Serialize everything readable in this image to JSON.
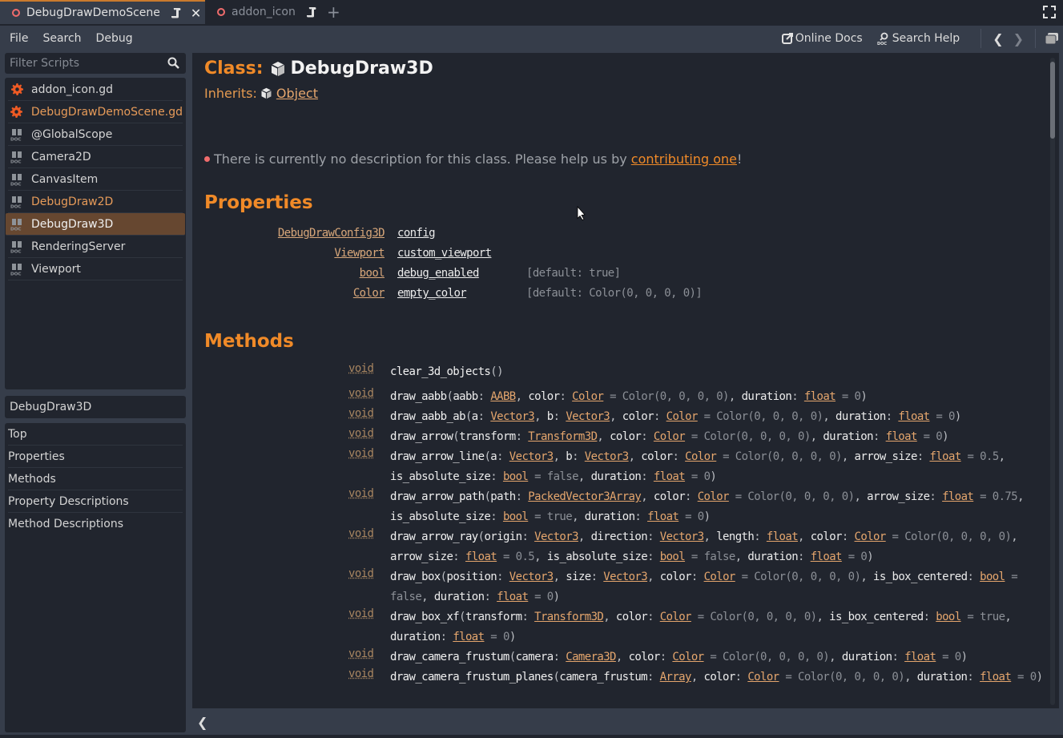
{
  "tabs": [
    {
      "label": "DebugDrawDemoScene",
      "active": true,
      "closable": true
    },
    {
      "label": "addon_icon",
      "active": false,
      "closable": false
    }
  ],
  "menu": [
    "File",
    "Search",
    "Debug"
  ],
  "toolbar": {
    "online_docs": "Online Docs",
    "search_help": "Search Help"
  },
  "filter": {
    "placeholder": "Filter Scripts",
    "value": ""
  },
  "scripts": [
    {
      "label": "addon_icon.gd",
      "icon": "gear-icon",
      "highlight": false,
      "selected": false
    },
    {
      "label": "DebugDrawDemoScene.gd",
      "icon": "gear-icon",
      "highlight": true,
      "selected": false
    },
    {
      "label": "@GlobalScope",
      "icon": "doc-icon",
      "highlight": false,
      "selected": false
    },
    {
      "label": "Camera2D",
      "icon": "doc-icon",
      "highlight": false,
      "selected": false
    },
    {
      "label": "CanvasItem",
      "icon": "doc-icon",
      "highlight": false,
      "selected": false
    },
    {
      "label": "DebugDraw2D",
      "icon": "doc-icon",
      "highlight": true,
      "selected": false
    },
    {
      "label": "DebugDraw3D",
      "icon": "doc-icon",
      "highlight": false,
      "selected": true
    },
    {
      "label": "RenderingServer",
      "icon": "doc-icon",
      "highlight": false,
      "selected": false
    },
    {
      "label": "Viewport",
      "icon": "doc-icon",
      "highlight": false,
      "selected": false
    }
  ],
  "current_class": "DebugDraw3D",
  "sections": [
    "Top",
    "Properties",
    "Methods",
    "Property Descriptions",
    "Method Descriptions"
  ],
  "doc": {
    "class_label": "Class:",
    "class_name": "DebugDraw3D",
    "inherits_label": "Inherits:",
    "inherits_name": "Object",
    "nodesc_text": "There is currently no description for this class. Please help us by ",
    "nodesc_link": "contributing one",
    "nodesc_tail": "!",
    "properties_heading": "Properties",
    "methods_heading": "Methods",
    "properties": [
      {
        "type": "DebugDrawConfig3D",
        "name": "config",
        "default": ""
      },
      {
        "type": "Viewport",
        "name": "custom_viewport",
        "default": ""
      },
      {
        "type": "bool",
        "name": "debug_enabled",
        "default": "[default: true]"
      },
      {
        "type": "Color",
        "name": "empty_color",
        "default": "[default: Color(0, 0, 0, 0)]"
      }
    ],
    "methods": [
      {
        "ret": "void",
        "name": "clear_3d_objects",
        "params": []
      },
      {
        "ret": "void",
        "name": "draw_aabb",
        "params": [
          {
            "n": "aabb",
            "t": "AABB"
          },
          {
            "n": "color",
            "t": "Color",
            "d": "Color(0, 0, 0, 0)"
          },
          {
            "n": "duration",
            "t": "float",
            "d": "0"
          }
        ]
      },
      {
        "ret": "void",
        "name": "draw_aabb_ab",
        "params": [
          {
            "n": "a",
            "t": "Vector3"
          },
          {
            "n": "b",
            "t": "Vector3"
          },
          {
            "n": "color",
            "t": "Color",
            "d": "Color(0, 0, 0, 0)"
          },
          {
            "n": "duration",
            "t": "float",
            "d": "0"
          }
        ]
      },
      {
        "ret": "void",
        "name": "draw_arrow",
        "params": [
          {
            "n": "transform",
            "t": "Transform3D"
          },
          {
            "n": "color",
            "t": "Color",
            "d": "Color(0, 0, 0, 0)"
          },
          {
            "n": "duration",
            "t": "float",
            "d": "0"
          }
        ]
      },
      {
        "ret": "void",
        "name": "draw_arrow_line",
        "params": [
          {
            "n": "a",
            "t": "Vector3"
          },
          {
            "n": "b",
            "t": "Vector3"
          },
          {
            "n": "color",
            "t": "Color",
            "d": "Color(0, 0, 0, 0)"
          },
          {
            "n": "arrow_size",
            "t": "float",
            "d": "0.5"
          },
          {
            "n": "is_absolute_size",
            "t": "bool",
            "d": "false"
          },
          {
            "n": "duration",
            "t": "float",
            "d": "0"
          }
        ]
      },
      {
        "ret": "void",
        "name": "draw_arrow_path",
        "params": [
          {
            "n": "path",
            "t": "PackedVector3Array"
          },
          {
            "n": "color",
            "t": "Color",
            "d": "Color(0, 0, 0, 0)"
          },
          {
            "n": "arrow_size",
            "t": "float",
            "d": "0.75"
          },
          {
            "n": "is_absolute_size",
            "t": "bool",
            "d": "true"
          },
          {
            "n": "duration",
            "t": "float",
            "d": "0"
          }
        ]
      },
      {
        "ret": "void",
        "name": "draw_arrow_ray",
        "params": [
          {
            "n": "origin",
            "t": "Vector3"
          },
          {
            "n": "direction",
            "t": "Vector3"
          },
          {
            "n": "length",
            "t": "float"
          },
          {
            "n": "color",
            "t": "Color",
            "d": "Color(0, 0, 0, 0)"
          },
          {
            "n": "arrow_size",
            "t": "float",
            "d": "0.5"
          },
          {
            "n": "is_absolute_size",
            "t": "bool",
            "d": "false"
          },
          {
            "n": "duration",
            "t": "float",
            "d": "0"
          }
        ]
      },
      {
        "ret": "void",
        "name": "draw_box",
        "params": [
          {
            "n": "position",
            "t": "Vector3"
          },
          {
            "n": "size",
            "t": "Vector3"
          },
          {
            "n": "color",
            "t": "Color",
            "d": "Color(0, 0, 0, 0)"
          },
          {
            "n": "is_box_centered",
            "t": "bool",
            "d": "false"
          },
          {
            "n": "duration",
            "t": "float",
            "d": "0"
          }
        ]
      },
      {
        "ret": "void",
        "name": "draw_box_xf",
        "params": [
          {
            "n": "transform",
            "t": "Transform3D"
          },
          {
            "n": "color",
            "t": "Color",
            "d": "Color(0, 0, 0, 0)"
          },
          {
            "n": "is_box_centered",
            "t": "bool",
            "d": "true"
          },
          {
            "n": "duration",
            "t": "float",
            "d": "0"
          }
        ]
      },
      {
        "ret": "void",
        "name": "draw_camera_frustum",
        "params": [
          {
            "n": "camera",
            "t": "Camera3D"
          },
          {
            "n": "color",
            "t": "Color",
            "d": "Color(0, 0, 0, 0)"
          },
          {
            "n": "duration",
            "t": "float",
            "d": "0"
          }
        ]
      },
      {
        "ret": "void",
        "name": "draw_camera_frustum_planes",
        "params": [
          {
            "n": "camera_frustum",
            "t": "Array"
          },
          {
            "n": "color",
            "t": "Color",
            "d": "Color(0, 0, 0, 0)"
          },
          {
            "n": "duration",
            "t": "float",
            "d": "0"
          }
        ]
      }
    ]
  },
  "colors": {
    "accent": "#f08a28",
    "selected_bg": "#664730",
    "panel_bg": "#21252e",
    "editor_bg": "#363d4a"
  }
}
